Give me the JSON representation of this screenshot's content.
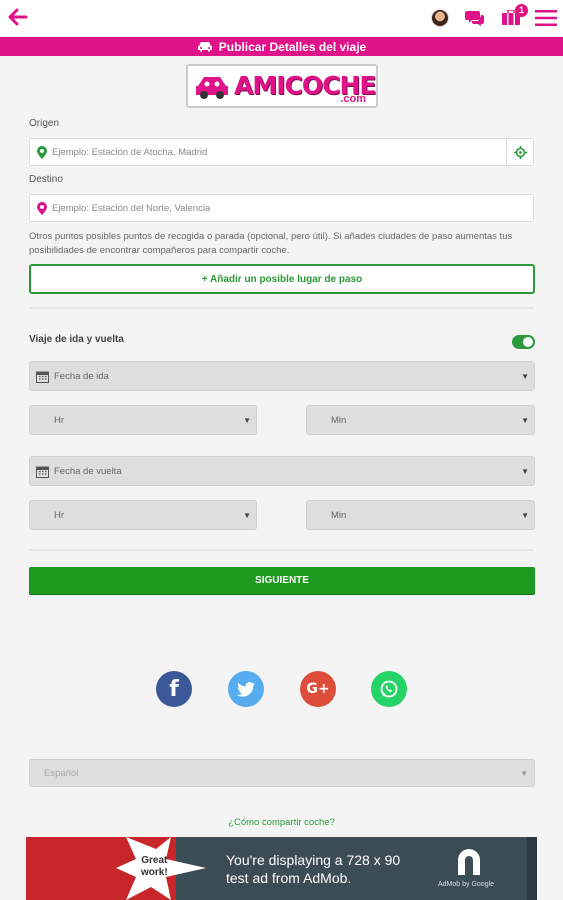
{
  "header": {
    "notification_count": "1"
  },
  "banner": {
    "title": "Publicar Detalles del viaje"
  },
  "logo": {
    "text": "AMICOCHE",
    "suffix": ".com"
  },
  "origin": {
    "label": "Origen",
    "placeholder": "Ejemplo: Estación de Atocha, Madrid"
  },
  "destination": {
    "label": "Destino",
    "placeholder": "Ejemplo: Estación del Norte, Valencia"
  },
  "waypoints": {
    "help": "Otros puntos posibles puntos de recogida o parada (opcional, pero útil). Si añades ciudades de paso aumentas tus posibilidades de encontrar compañeros para compartir coche.",
    "add_button": "+ Añadir un posible lugar de paso"
  },
  "round_trip": {
    "label": "Viaje de ida y vuelta",
    "enabled": true
  },
  "outbound": {
    "date_placeholder": "Fecha de ida",
    "hour_placeholder": "Hr",
    "minute_placeholder": "Min"
  },
  "return": {
    "date_placeholder": "Fecha de vuelta",
    "hour_placeholder": "Hr",
    "minute_placeholder": "Min"
  },
  "next_button": "SIGUIENTE",
  "social": {
    "facebook_glyph": "f",
    "googleplus_glyph": "G+"
  },
  "language": {
    "selected": "Español"
  },
  "how_to_link": "¿Cómo compartir coche?",
  "ad": {
    "badge": "Great\nwork!",
    "message": "You're displaying a 728 x 90 test ad from AdMob.",
    "brand": "AdMob by Google"
  },
  "colors": {
    "brand_pink": "#e0128a",
    "accent_green": "#2c9a3a",
    "facebook": "#3b5998",
    "twitter": "#55acee",
    "googleplus": "#dd4b39",
    "whatsapp": "#25d366"
  }
}
